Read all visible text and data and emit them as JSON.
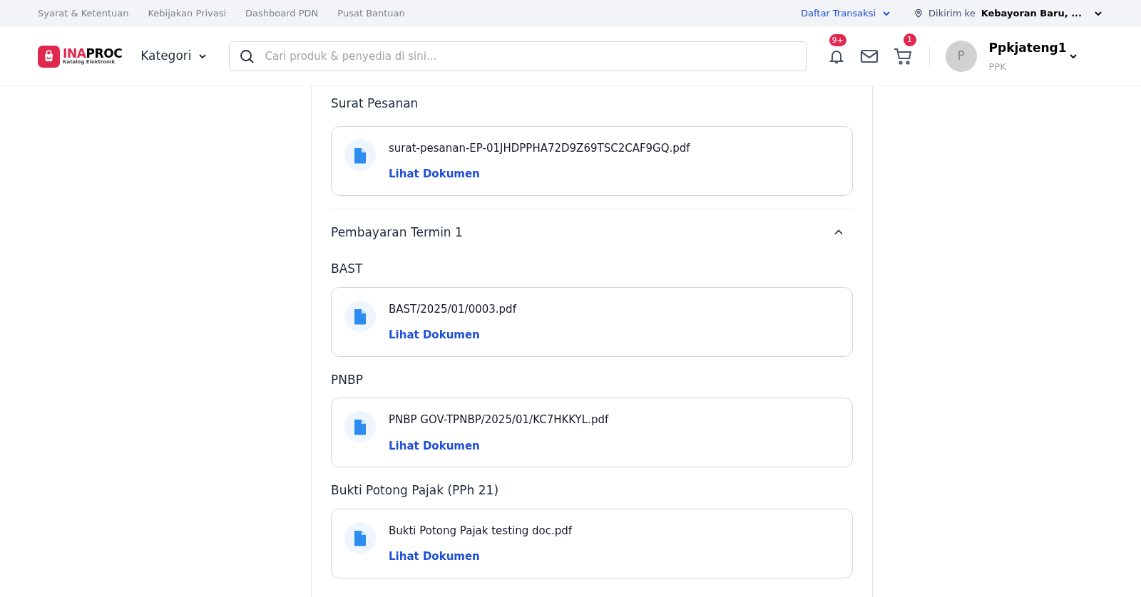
{
  "top_bar": {
    "links": [
      "Syarat & Ketentuan",
      "Kebijakan Privasi",
      "Dashboard PDN",
      "Pusat Bantuan"
    ],
    "transactions": "Daftar Transaksi",
    "delivery_label": "Dikirim ke",
    "delivery_location": "Kebayoran Baru, ..."
  },
  "header": {
    "logo": {
      "part_1": "INA",
      "part_2": "PROC",
      "tagline": "Katalog Elektronik"
    },
    "category": "Kategori",
    "search": {
      "placeholder": "Cari produk & penyedia di sini..."
    },
    "notification_badge": "9+",
    "cart_badge": "1",
    "user": {
      "initial": "P",
      "name": "Ppkjateng1",
      "role": "PPK"
    }
  },
  "sections": [
    {
      "kind": "documents",
      "title": "Surat Pesanan",
      "documents": [
        {
          "file": "surat-pesanan-EP-01JHDPPHA72D9Z69TSC2CAF9GQ.pdf",
          "link": "Lihat Dokumen"
        }
      ]
    },
    {
      "kind": "termin",
      "title": "Pembayaran Termin 1",
      "expanded": true,
      "groups": [
        {
          "title": "BAST",
          "documents": [
            {
              "file": "BAST/2025/01/0003.pdf",
              "link": "Lihat Dokumen"
            }
          ]
        },
        {
          "title": "PNBP",
          "documents": [
            {
              "file": "PNBP GOV-TPNBP/2025/01/KC7HKKYL.pdf",
              "link": "Lihat Dokumen"
            }
          ]
        },
        {
          "title": "Bukti Potong Pajak (PPh 21)",
          "documents": [
            {
              "file": "Bukti Potong Pajak testing doc.pdf",
              "link": "Lihat Dokumen"
            }
          ]
        }
      ]
    }
  ]
}
